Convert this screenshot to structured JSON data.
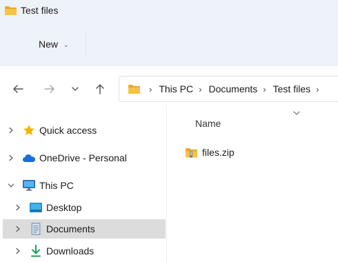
{
  "window": {
    "title": "Test files"
  },
  "toolbar": {
    "new_label": "New"
  },
  "address": {
    "crumbs": [
      "This PC",
      "Documents",
      "Test files"
    ]
  },
  "content": {
    "column_header": "Name",
    "files": [
      {
        "name": "files.zip",
        "icon": "zip-folder-icon"
      }
    ]
  },
  "nav_pane": {
    "items": [
      {
        "label": "Quick access",
        "icon": "star-icon",
        "expanded": false
      },
      {
        "label": "OneDrive - Personal",
        "icon": "cloud-icon",
        "expanded": false
      },
      {
        "label": "This PC",
        "icon": "monitor-icon",
        "expanded": true
      },
      {
        "label": "Desktop",
        "icon": "desktop-icon",
        "expanded": false
      },
      {
        "label": "Documents",
        "icon": "documents-icon",
        "expanded": false,
        "selected": true
      },
      {
        "label": "Downloads",
        "icon": "download-icon",
        "expanded": false
      }
    ]
  },
  "colors": {
    "titlebar_bg": "#eef2f9",
    "folder_yellow": "#f6c343",
    "selection_bg": "#dcdcdc",
    "star": "#f5b400",
    "onedrive_blue": "#1b6ed8",
    "download_green": "#1e9e5a"
  }
}
